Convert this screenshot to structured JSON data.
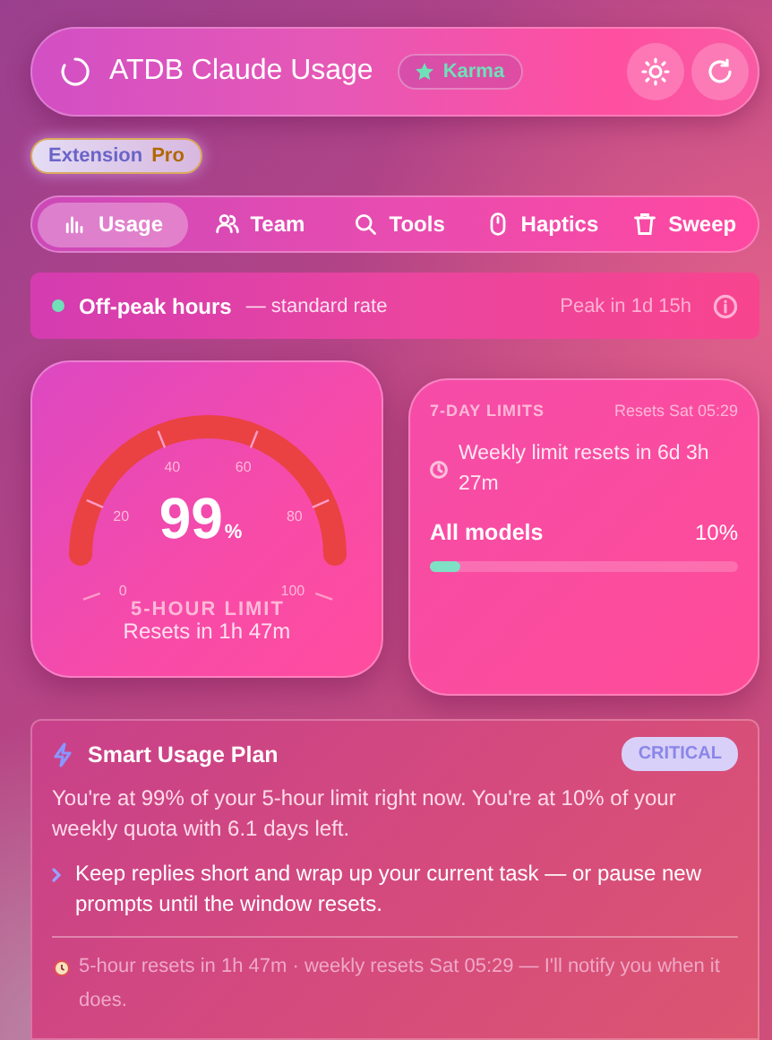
{
  "header": {
    "title": "ATDB Claude Usage",
    "badge": "Karma"
  },
  "edition": {
    "label": "Extension",
    "tier": "Pro"
  },
  "tabs": [
    {
      "label": "Usage",
      "selected": true
    },
    {
      "label": "Team",
      "selected": false
    },
    {
      "label": "Tools",
      "selected": false
    },
    {
      "label": "Haptics",
      "selected": false
    },
    {
      "label": "Sweep",
      "selected": false
    }
  ],
  "peak_status": {
    "off_peak": true,
    "label": "Off-peak hours",
    "note": "— standard rate",
    "countdown": "Peak in 1d 15h"
  },
  "five_hour": {
    "value": "99",
    "unit": "%",
    "ticks": [
      "0",
      "20",
      "40",
      "60",
      "80",
      "100"
    ],
    "label": "5-HOUR LIMIT",
    "resets": "Resets in 1h 47m"
  },
  "seven_day": {
    "title": "7-DAY LIMITS",
    "resets": "Resets Sat 05:29",
    "note": "Weekly limit resets in 6d 3h 27m",
    "models": [
      {
        "name": "All models",
        "reading": "10%",
        "level": 0.1
      }
    ]
  },
  "smart_plan": {
    "title": "Smart Usage Plan",
    "severity": "CRITICAL",
    "summary": "You're at 99% of your 5-hour limit right now. You're at 10% of your weekly quota with 6.1 days left.",
    "tips": [
      "Keep replies short and wrap up your current task — or pause new prompts until the window resets."
    ],
    "footer": "5-hour resets in 1h 47m · weekly resets Sat 05:29 — I'll notify you when it does."
  }
}
